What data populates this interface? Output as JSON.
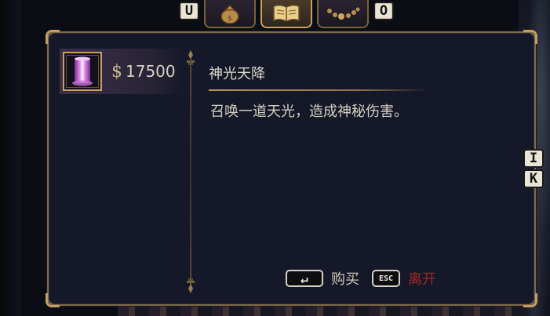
{
  "tabs": {
    "left_key": "U",
    "right_key": "O",
    "items": [
      {
        "icon": "money-bag-icon",
        "active": false
      },
      {
        "icon": "spellbook-icon",
        "active": true
      },
      {
        "icon": "bead-necklace-icon",
        "active": false
      }
    ]
  },
  "shop": {
    "items": [
      {
        "icon": "light-pillar-icon",
        "price": "17500",
        "currency_icon": "coin-icon",
        "selected": true
      }
    ]
  },
  "detail": {
    "title": "神光天降",
    "description": "召唤一道天光，造成神秘伤害。"
  },
  "actions": {
    "buy_key": "↵",
    "buy_label": "购买",
    "leave_key": "ESC",
    "leave_label": "离开"
  },
  "side_keys": {
    "upper": "I",
    "lower": "K"
  },
  "colors": {
    "panel_bg": "#141828",
    "gold_border": "#c2a064",
    "selected_row": "#3b2f48",
    "leave_red": "#9e2a25",
    "text": "#d8d2c0"
  }
}
